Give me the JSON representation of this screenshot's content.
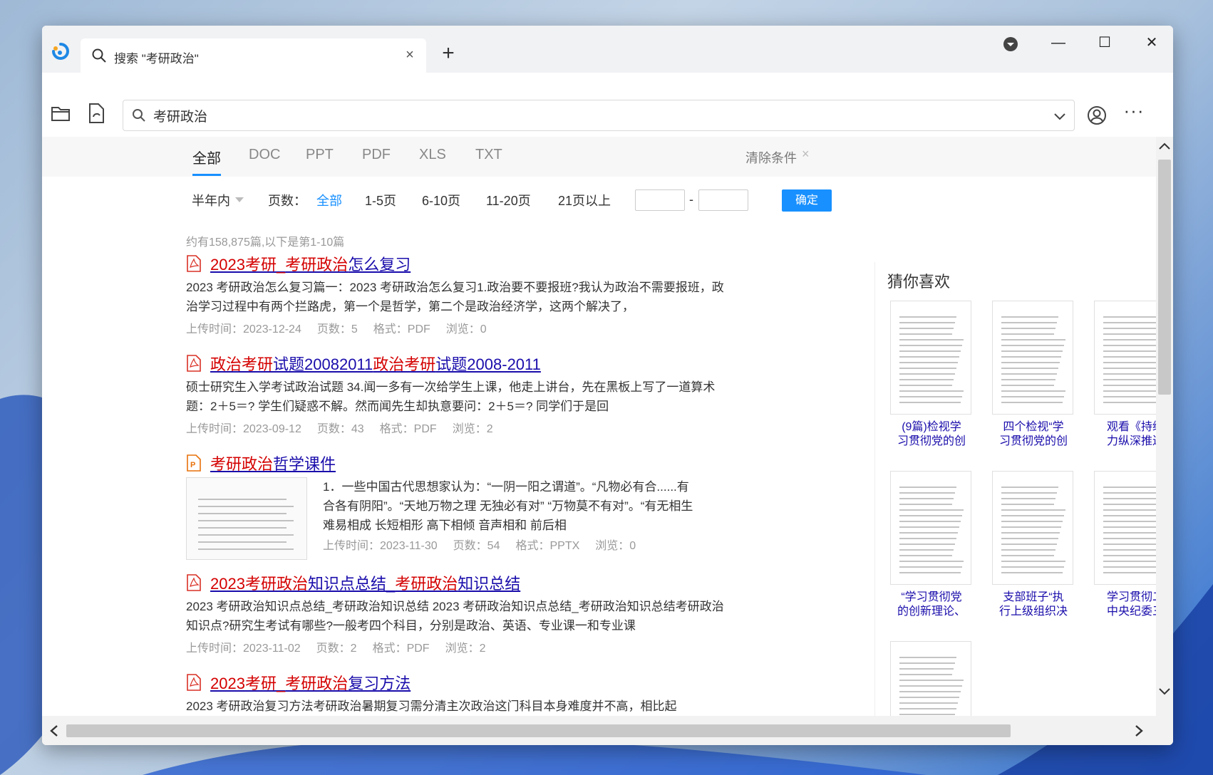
{
  "tab": {
    "title": "搜索 \"考研政治\""
  },
  "address": {
    "value": "考研政治"
  },
  "type_tabs": [
    "全部",
    "DOC",
    "PPT",
    "PDF",
    "XLS",
    "TXT"
  ],
  "clear_conditions": "清除条件",
  "time_filter": "半年内",
  "page_filter": {
    "label": "页数：",
    "options": [
      "全部",
      "1-5页",
      "6-10页",
      "11-20页",
      "21页以上"
    ],
    "dash": "-",
    "confirm": "确定"
  },
  "result_count": "约有158,875篇,以下是第1-10篇",
  "results": [
    {
      "type": "pdf",
      "title_parts": [
        {
          "t": "2023考研_",
          "hl": true
        },
        {
          "t": "考研政治",
          "hl": true
        },
        {
          "t": "怎么复习",
          "hl": false
        }
      ],
      "snippet": "2023 考研政治怎么复习篇一：2023 考研政治怎么复习1.政治要不要报班?我认为政治不需要报班，政治学习过程中有两个拦路虎，第一个是哲学，第二个是政治经济学，这两个解决了，",
      "upload": "上传时间：2023-12-24",
      "pages": "页数：5",
      "format": "格式：PDF",
      "views": "浏览：0"
    },
    {
      "type": "pdf",
      "title_parts": [
        {
          "t": "政治考研",
          "hl": true
        },
        {
          "t": "试题20082011",
          "hl": false
        },
        {
          "t": "政治考研",
          "hl": true
        },
        {
          "t": "试题2008-2011",
          "hl": false
        }
      ],
      "snippet": "硕士研究生入学考试政治试题 34.闻一多有一次给学生上课，他走上讲台，先在黑板上写了一道算术题：2＋5＝? 学生们疑惑不解。然而闻先生却执意要问：2＋5＝? 同学们于是回",
      "upload": "上传时间：2023-09-12",
      "pages": "页数：43",
      "format": "格式：PDF",
      "views": "浏览：2"
    },
    {
      "type": "ppt",
      "title_parts": [
        {
          "t": "考研政治",
          "hl": true
        },
        {
          "t": "哲学课件",
          "hl": false
        }
      ],
      "snippet": "1．一些中国古代思想家认为：“一阴一阳之谓道”。“凡物必有合......有合各有阴阳”。“天地万物之理 无独必有对” “万物莫不有对”。“有无相生 难易相成 长短相形 高下相倾 音声相和 前后相",
      "upload": "上传时间：2023-11-30",
      "pages": "页数：54",
      "format": "格式：PPTX",
      "views": "浏览：0"
    },
    {
      "type": "pdf",
      "title_parts": [
        {
          "t": "2023考研政治",
          "hl": true
        },
        {
          "t": "知识点总结_",
          "hl": false
        },
        {
          "t": "考研政治",
          "hl": true
        },
        {
          "t": "知识总结",
          "hl": false
        }
      ],
      "snippet": "2023 考研政治知识点总结_考研政治知识总结 2023 考研政治知识点总结_考研政治知识总结考研政治知识点?研究生考试有哪些?一般考四个科目，分别是政治、英语、专业课一和专业课",
      "upload": "上传时间：2023-11-02",
      "pages": "页数：2",
      "format": "格式：PDF",
      "views": "浏览：2"
    },
    {
      "type": "pdf",
      "title_parts": [
        {
          "t": "2023考研_",
          "hl": true
        },
        {
          "t": "考研政治",
          "hl": true
        },
        {
          "t": "复习方法",
          "hl": false
        }
      ],
      "snippet": "2023 考研政治复习方法考研政治暑期复习需分清主次政治这门科目本身难度并不高，相比起",
      "upload": "",
      "pages": "",
      "format": "",
      "views": ""
    }
  ],
  "sidebar": {
    "title": "猜你喜欢",
    "items": [
      {
        "caption": "(9篇)检视学\n习贯彻党的创"
      },
      {
        "caption": "四个检视“学\n习贯彻党的创"
      },
      {
        "caption": "观看《持续\n力纵深推进"
      },
      {
        "caption": "“学习贯彻党\n的创新理论、"
      },
      {
        "caption": "支部班子“执\n行上级组织决"
      },
      {
        "caption": "学习贯彻二\n中央纪委三"
      },
      {
        "caption": ""
      }
    ]
  },
  "colors": {
    "accent": "#1890ff",
    "highlight": "#d40000",
    "link": "#1a0dab"
  }
}
